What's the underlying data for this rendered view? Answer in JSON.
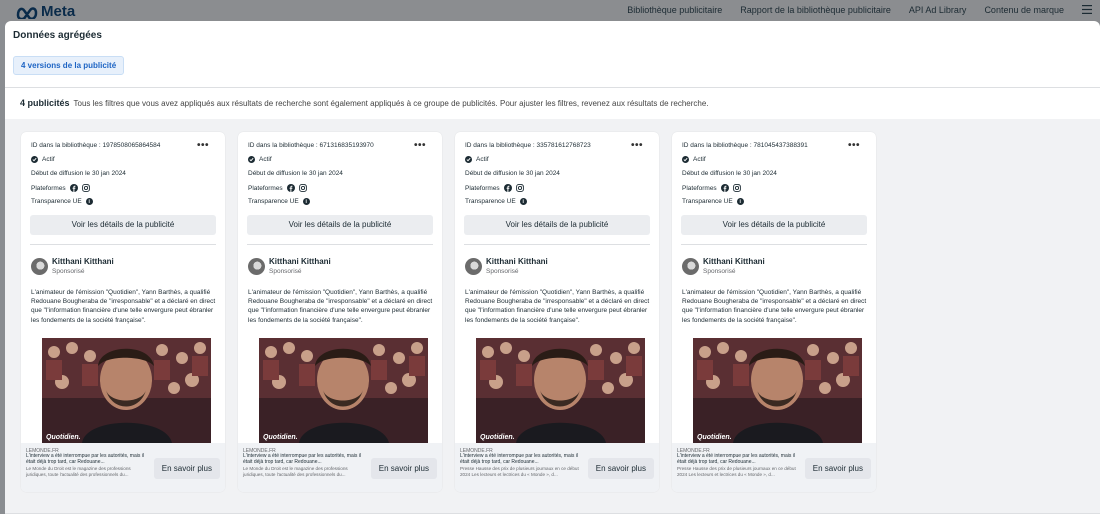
{
  "header": {
    "brand": "Meta",
    "nav": [
      "Bibliothèque publicitaire",
      "Rapport de la bibliothèque publicitaire",
      "API Ad Library",
      "Contenu de marque"
    ],
    "menu_icon": "menu-icon"
  },
  "modal": {
    "title": "Données agrégées",
    "versions_pill": "4 versions de la publicité",
    "summary_count": "4 publicités",
    "summary_text": "Tous les filtres que vous avez appliqués aux résultats de recherche sont également appliqués à ce groupe de publicités. Pour ajuster les filtres, revenez aux résultats de recherche."
  },
  "cards": [
    {
      "library_id": "ID dans la bibliothèque : 1978508065864584",
      "status": "Actif",
      "start_date": "Début de diffusion le 30 jan 2024",
      "platforms_label": "Plateformes",
      "transparency_label": "Transparence UE",
      "details_button": "Voir les détails de la publicité",
      "advertiser": "Kitthani Kitthani",
      "sponsored": "Sponsorisé",
      "body": "L'animateur de l'émission \"Quotidien\", Yann Barthès, a qualifié Redouane Bougheraba de \"irresponsable\" et a déclaré en direct que \"l'information financière d'une telle envergure peut ébranler les fondements de la société française\".",
      "image_label": "Quotidien.",
      "link_domain": "LEMONDE.FR",
      "link_title": "L'interview a été interrompue par les autorités, mais il était déjà trop tard, car Redouane...",
      "link_desc": "Le Monde du Droit est le magazine des professions juridiques, toute l'actualité des professionnels du...",
      "cta": "En savoir plus"
    },
    {
      "library_id": "ID dans la bibliothèque : 671316835193970",
      "status": "Actif",
      "start_date": "Début de diffusion le 30 jan 2024",
      "platforms_label": "Plateformes",
      "transparency_label": "Transparence UE",
      "details_button": "Voir les détails de la publicité",
      "advertiser": "Kitthani Kitthani",
      "sponsored": "Sponsorisé",
      "body": "L'animateur de l'émission \"Quotidien\", Yann Barthès, a qualifié Redouane Bougheraba de \"irresponsable\" et a déclaré en direct que \"l'information financière d'une telle envergure peut ébranler les fondements de la société française\".",
      "image_label": "Quotidien.",
      "link_domain": "LEMONDE.FR",
      "link_title": "L'interview a été interrompue par les autorités, mais il était déjà trop tard, car Redouane...",
      "link_desc": "Le Monde du Droit est le magazine des professions juridiques, toute l'actualité des professionnels du...",
      "cta": "En savoir plus"
    },
    {
      "library_id": "ID dans la bibliothèque : 335781612768723",
      "status": "Actif",
      "start_date": "Début de diffusion le 30 jan 2024",
      "platforms_label": "Plateformes",
      "transparency_label": "Transparence UE",
      "details_button": "Voir les détails de la publicité",
      "advertiser": "Kitthani Kitthani",
      "sponsored": "Sponsorisé",
      "body": "L'animateur de l'émission \"Quotidien\", Yann Barthès, a qualifié Redouane Bougheraba de \"irresponsable\" et a déclaré en direct que \"l'information financière d'une telle envergure peut ébranler les fondements de la société française\".",
      "image_label": "Quotidien.",
      "link_domain": "LEMONDE.FR",
      "link_title": "L'interview a été interrompue par les autorités, mais il était déjà trop tard, car Redouane...",
      "link_desc": "Presse Hausse des prix de plusieurs journaux en ce début 2024 Les lecteurs et lectrices du « Monde », d...",
      "cta": "En savoir plus"
    },
    {
      "library_id": "ID dans la bibliothèque : 781045437388391",
      "status": "Actif",
      "start_date": "Début de diffusion le 30 jan 2024",
      "platforms_label": "Plateformes",
      "transparency_label": "Transparence UE",
      "details_button": "Voir les détails de la publicité",
      "advertiser": "Kitthani Kitthani",
      "sponsored": "Sponsorisé",
      "body": "L'animateur de l'émission \"Quotidien\", Yann Barthès, a qualifié Redouane Bougheraba de \"irresponsable\" et a déclaré en direct que \"l'information financière d'une telle envergure peut ébranler les fondements de la société française\".",
      "image_label": "Quotidien.",
      "link_domain": "LEMONDE.FR",
      "link_title": "L'interview a été interrompue par les autorités, mais il était déjà trop tard, car Redouane...",
      "link_desc": "Presse Hausse des prix de plusieurs journaux en ce début 2024 Les lecteurs et lectrices du « Monde », d...",
      "cta": "En savoir plus"
    }
  ],
  "colors": {
    "brand": "#0a2b4a",
    "pill_text": "#1d64c4",
    "pill_bg": "#e7f0fb"
  }
}
